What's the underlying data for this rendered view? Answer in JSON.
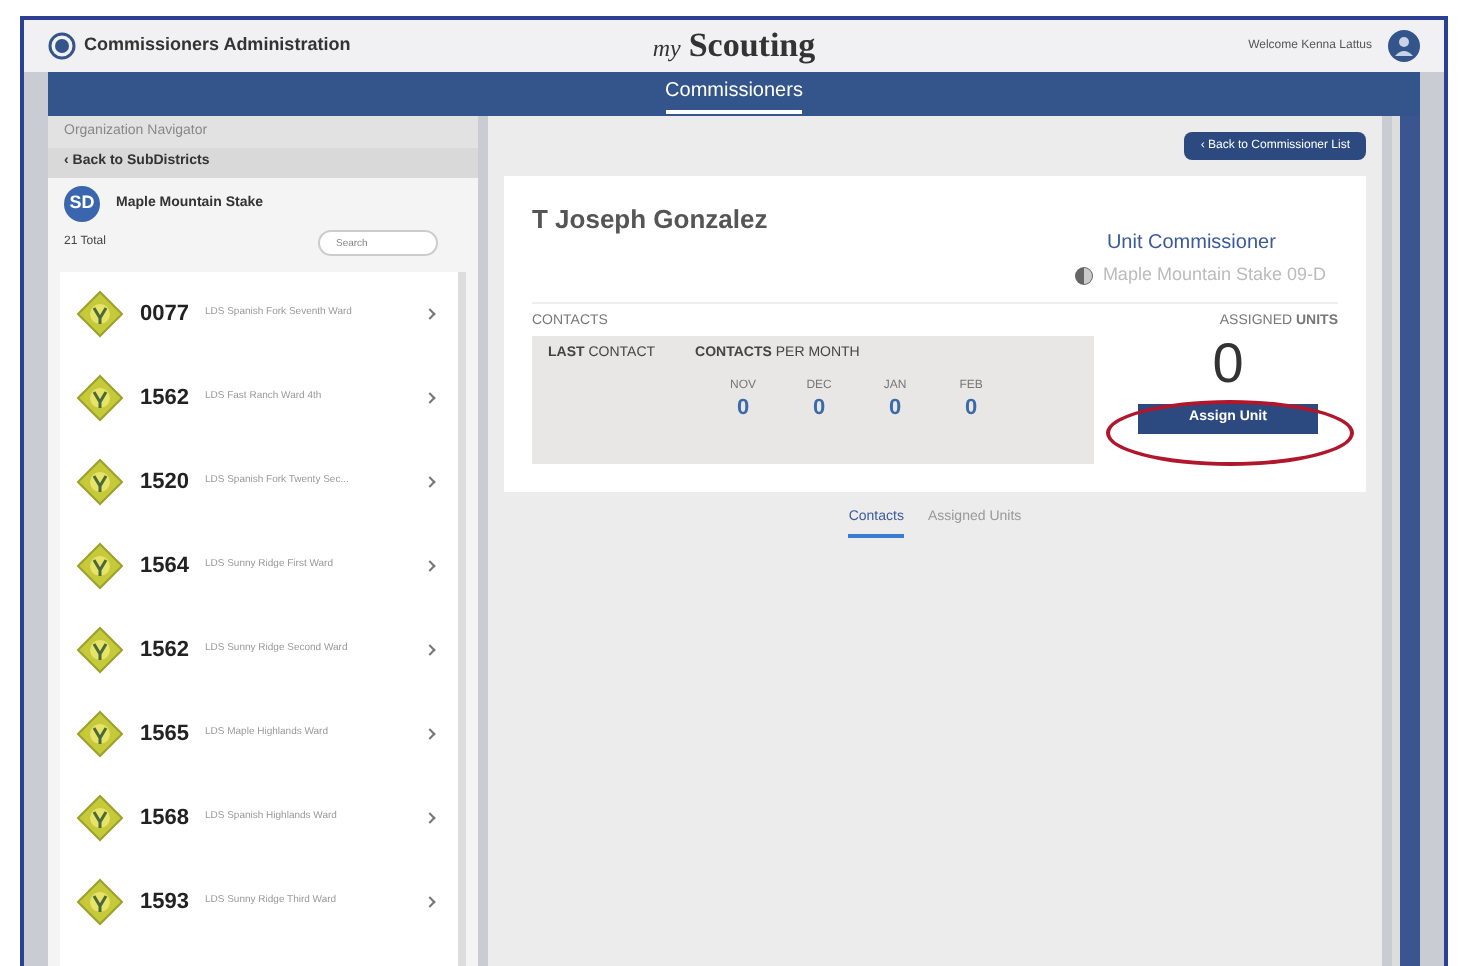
{
  "header": {
    "app_title": "Commissioners Administration",
    "logo_prefix": "my",
    "logo_name": "Scouting",
    "welcome": "Welcome Kenna Lattus"
  },
  "nav": {
    "title": "Commissioners"
  },
  "sidebar": {
    "title": "Organization Navigator",
    "back": "‹ Back to SubDistricts",
    "org_initials": "SD",
    "org_name": "Maple Mountain Stake",
    "total": "21 Total",
    "search_placeholder": "Search",
    "units": [
      {
        "number": "0077",
        "name": "LDS Spanish Fork Seventh Ward"
      },
      {
        "number": "1562",
        "name": "LDS Fast Ranch Ward 4th"
      },
      {
        "number": "1520",
        "name": "LDS Spanish Fork Twenty Sec..."
      },
      {
        "number": "1564",
        "name": "LDS Sunny Ridge First Ward"
      },
      {
        "number": "1562",
        "name": "LDS Sunny Ridge Second Ward"
      },
      {
        "number": "1565",
        "name": "LDS Maple Highlands Ward"
      },
      {
        "number": "1568",
        "name": "LDS Spanish Highlands Ward"
      },
      {
        "number": "1593",
        "name": "LDS Sunny Ridge Third Ward"
      }
    ]
  },
  "back_button": "‹ Back to Commissioner List",
  "profile": {
    "name": "T Joseph Gonzalez",
    "role": "Unit Commissioner",
    "org": "Maple Mountain Stake 09-D"
  },
  "contacts": {
    "label": "CONTACTS",
    "last_contact": "**LAST** CONTACT",
    "per_month": "**CONTACTS** PER MONTH",
    "months": [
      {
        "label": "NOV",
        "value": "0"
      },
      {
        "label": "DEC",
        "value": "0"
      },
      {
        "label": "JAN",
        "value": "0"
      },
      {
        "label": "FEB",
        "value": "0"
      }
    ]
  },
  "assigned": {
    "label": "ASSIGNED **UNITS**",
    "count": "0",
    "button": "Assign Unit",
    "highlighted": true
  },
  "tabs": [
    {
      "label": "Contacts",
      "selected": true
    },
    {
      "label": "Assigned Units",
      "selected": false
    }
  ]
}
